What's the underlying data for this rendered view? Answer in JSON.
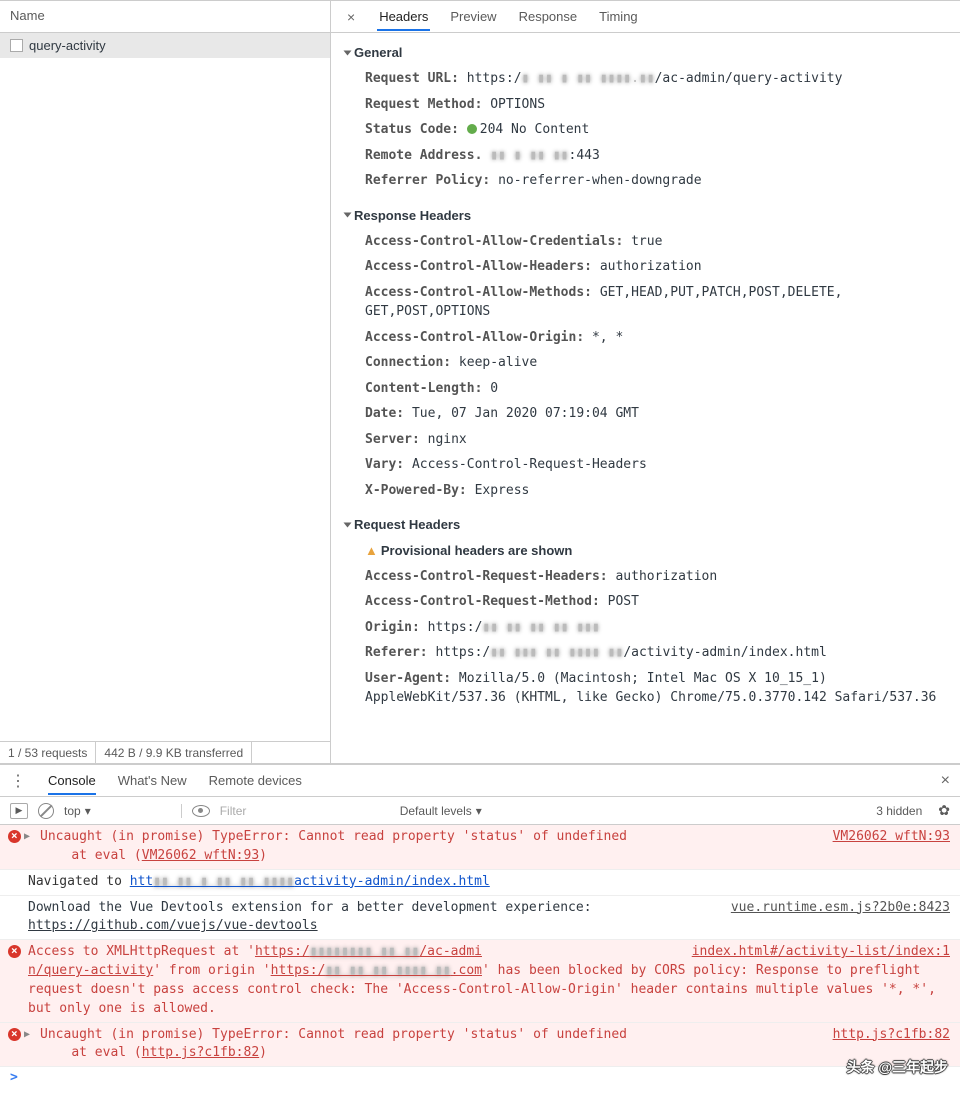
{
  "namePanel": {
    "header": "Name",
    "items": [
      "query-activity"
    ],
    "footer": {
      "requests": "1 / 53 requests",
      "transferred": "442 B / 9.9 KB transferred"
    }
  },
  "detailTabs": [
    "Headers",
    "Preview",
    "Response",
    "Timing"
  ],
  "general": {
    "title": "General",
    "requestUrlLabel": "Request URL:",
    "requestUrlPrefix": "https:/",
    "requestUrlSuffix": "/ac-admin/query-activity",
    "requestMethodLabel": "Request Method:",
    "requestMethod": "OPTIONS",
    "statusLabel": "Status Code:",
    "statusCode": "204 No Content",
    "remoteLabel": "Remote Address.",
    "remotePort": ":443",
    "refPolicyLabel": "Referrer Policy:",
    "refPolicy": "no-referrer-when-downgrade"
  },
  "responseHeaders": {
    "title": "Response Headers",
    "rows": [
      {
        "k": "Access-Control-Allow-Credentials:",
        "v": "true"
      },
      {
        "k": "Access-Control-Allow-Headers:",
        "v": "authorization"
      },
      {
        "k": "Access-Control-Allow-Methods:",
        "v": "GET,HEAD,PUT,PATCH,POST,DELETE, GET,POST,OPTIONS"
      },
      {
        "k": "Access-Control-Allow-Origin:",
        "v": "*, *"
      },
      {
        "k": "Connection:",
        "v": "keep-alive"
      },
      {
        "k": "Content-Length:",
        "v": "0"
      },
      {
        "k": "Date:",
        "v": "Tue, 07 Jan 2020 07:19:04 GMT"
      },
      {
        "k": "Server:",
        "v": "nginx"
      },
      {
        "k": "Vary:",
        "v": "Access-Control-Request-Headers"
      },
      {
        "k": "X-Powered-By:",
        "v": "Express"
      }
    ]
  },
  "requestHeaders": {
    "title": "Request Headers",
    "provisional": "Provisional headers are shown",
    "rows": [
      {
        "k": "Access-Control-Request-Headers:",
        "v": "authorization"
      },
      {
        "k": "Access-Control-Request-Method:",
        "v": "POST"
      }
    ],
    "originLabel": "Origin:",
    "originPrefix": "https:/",
    "refererLabel": "Referer:",
    "refererPrefix": "https:/",
    "refererSuffix": "/activity-admin/index.html",
    "uaLabel": "User-Agent:",
    "ua": "Mozilla/5.0 (Macintosh; Intel Mac OS X 10_15_1) AppleWebKit/537.36 (KHTML, like Gecko) Chrome/75.0.3770.142 Safari/537.36"
  },
  "bottomTabs": [
    "Console",
    "What's New",
    "Remote devices"
  ],
  "consoleToolbar": {
    "context": "top",
    "filterPlaceholder": "Filter",
    "levels": "Default levels",
    "hidden": "3 hidden"
  },
  "console": {
    "err1": {
      "msg": "Uncaught (in promise) TypeError: Cannot read property 'status' of undefined",
      "at": "at eval (",
      "link": "VM26062 wftN:93",
      "src": "VM26062 wftN:93"
    },
    "nav": {
      "pre": "Navigated to ",
      "a": "htt",
      "suffix": "activity-admin/index.html"
    },
    "devtools": {
      "msg": "Download the Vue Devtools extension for a better development experience:",
      "link": "https://github.com/vuejs/vue-devtools",
      "src": "vue.runtime.esm.js?2b0e:8423"
    },
    "cors": {
      "l1a": "Access to XMLHttpRequest at '",
      "l1b": "https:/",
      "l1c": "/ac-admi",
      "src": "index.html#/activity-list/index:1",
      "l2a": "n/query-activity",
      "l2b": "' from origin '",
      "l2c": "https:/",
      "l2d": ".com",
      "l2e": "' has been blocked by CORS policy: Response to preflight request doesn't pass access control check: The 'Access-Control-Allow-Origin' header contains multiple values '*, *', but only one is allowed."
    },
    "err2": {
      "msg": "Uncaught (in promise) TypeError: Cannot read property 'status' of undefined",
      "at": "at eval (",
      "link": "http.js?c1fb:82",
      "src": "http.js?c1fb:82"
    }
  },
  "watermark": "头条 @三年起步"
}
